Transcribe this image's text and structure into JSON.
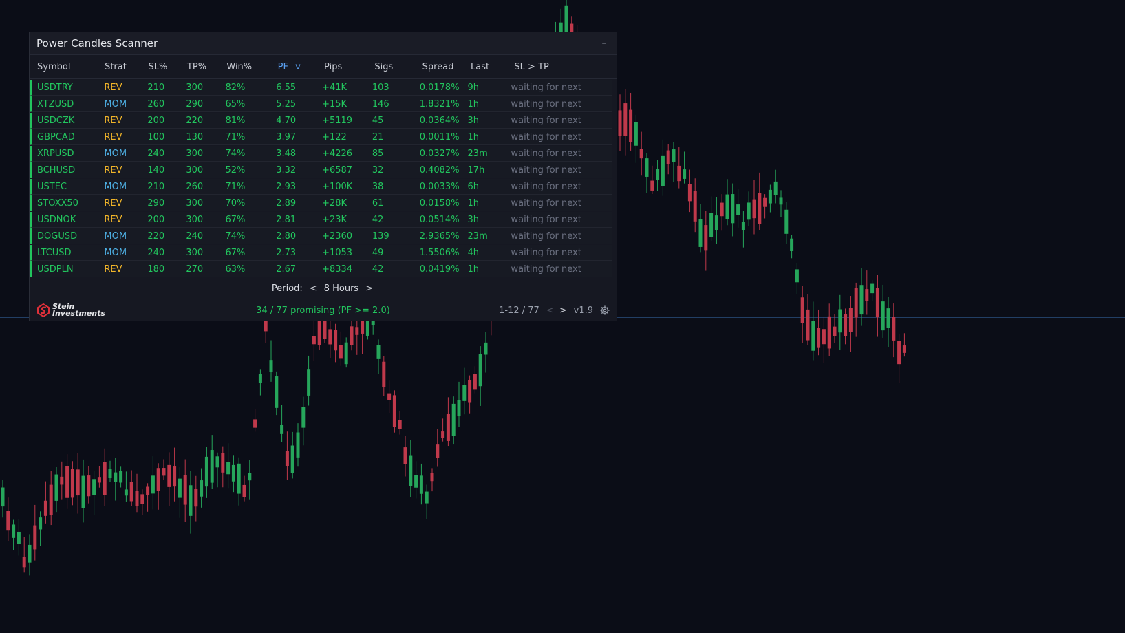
{
  "scanner": {
    "title": "Power Candles Scanner",
    "minimize_label": "–",
    "columns": {
      "symbol": "Symbol",
      "strat": "Strat",
      "sl": "SL%",
      "tp": "TP%",
      "win": "Win%",
      "pf": "PF",
      "pf_sort": "v",
      "pips": "Pips",
      "sigs": "Sigs",
      "spread": "Spread",
      "last": "Last",
      "sltp": "SL > TP"
    },
    "rows": [
      {
        "symbol": "USDTRY",
        "strat": "REV",
        "sl": "210",
        "tp": "300",
        "win": "82%",
        "pf": "6.55",
        "pips": "+41K",
        "sigs": "103",
        "spread": "0.0178%",
        "last": "9h",
        "sltp": "waiting for next"
      },
      {
        "symbol": "XTZUSD",
        "strat": "MOM",
        "sl": "260",
        "tp": "290",
        "win": "65%",
        "pf": "5.25",
        "pips": "+15K",
        "sigs": "146",
        "spread": "1.8321%",
        "last": "1h",
        "sltp": "waiting for next"
      },
      {
        "symbol": "USDCZK",
        "strat": "REV",
        "sl": "200",
        "tp": "220",
        "win": "81%",
        "pf": "4.70",
        "pips": "+5119",
        "sigs": "45",
        "spread": "0.0364%",
        "last": "3h",
        "sltp": "waiting for next"
      },
      {
        "symbol": "GBPCAD",
        "strat": "REV",
        "sl": "100",
        "tp": "130",
        "win": "71%",
        "pf": "3.97",
        "pips": "+122",
        "sigs": "21",
        "spread": "0.0011%",
        "last": "1h",
        "sltp": "waiting for next"
      },
      {
        "symbol": "XRPUSD",
        "strat": "MOM",
        "sl": "240",
        "tp": "300",
        "win": "74%",
        "pf": "3.48",
        "pips": "+4226",
        "sigs": "85",
        "spread": "0.0327%",
        "last": "23m",
        "sltp": "waiting for next"
      },
      {
        "symbol": "BCHUSD",
        "strat": "REV",
        "sl": "140",
        "tp": "300",
        "win": "52%",
        "pf": "3.32",
        "pips": "+6587",
        "sigs": "32",
        "spread": "0.4082%",
        "last": "17h",
        "sltp": "waiting for next"
      },
      {
        "symbol": "USTEC",
        "strat": "MOM",
        "sl": "210",
        "tp": "260",
        "win": "71%",
        "pf": "2.93",
        "pips": "+100K",
        "sigs": "38",
        "spread": "0.0033%",
        "last": "6h",
        "sltp": "waiting for next"
      },
      {
        "symbol": "STOXX50",
        "strat": "REV",
        "sl": "290",
        "tp": "300",
        "win": "70%",
        "pf": "2.89",
        "pips": "+28K",
        "sigs": "61",
        "spread": "0.0158%",
        "last": "1h",
        "sltp": "waiting for next"
      },
      {
        "symbol": "USDNOK",
        "strat": "REV",
        "sl": "200",
        "tp": "300",
        "win": "67%",
        "pf": "2.81",
        "pips": "+23K",
        "sigs": "42",
        "spread": "0.0514%",
        "last": "3h",
        "sltp": "waiting for next"
      },
      {
        "symbol": "DOGUSD",
        "strat": "MOM",
        "sl": "220",
        "tp": "240",
        "win": "74%",
        "pf": "2.80",
        "pips": "+2360",
        "sigs": "139",
        "spread": "2.9365%",
        "last": "23m",
        "sltp": "waiting for next"
      },
      {
        "symbol": "LTCUSD",
        "strat": "MOM",
        "sl": "240",
        "tp": "300",
        "win": "67%",
        "pf": "2.73",
        "pips": "+1053",
        "sigs": "49",
        "spread": "1.5506%",
        "last": "4h",
        "sltp": "waiting for next"
      },
      {
        "symbol": "USDPLN",
        "strat": "REV",
        "sl": "180",
        "tp": "270",
        "win": "63%",
        "pf": "2.67",
        "pips": "+8334",
        "sigs": "42",
        "spread": "0.0419%",
        "last": "1h",
        "sltp": "waiting for next"
      }
    ],
    "period": {
      "label": "Period:",
      "prev": "<",
      "value": "8 Hours",
      "next": ">"
    },
    "footer": {
      "logo_line1": "Stein",
      "logo_line2": "Investments",
      "status": "34 / 77 promising (PF >= 2.0)",
      "pagination": "1-12 / 77",
      "prev": "<",
      "next": ">",
      "version": "v1.9"
    }
  },
  "colors": {
    "background": "#0b0d17",
    "bull": "#26a65b",
    "bear": "#c0394b",
    "accent_green": "#22c55e",
    "rev": "#f0b429",
    "mom": "#4fb3e8"
  }
}
